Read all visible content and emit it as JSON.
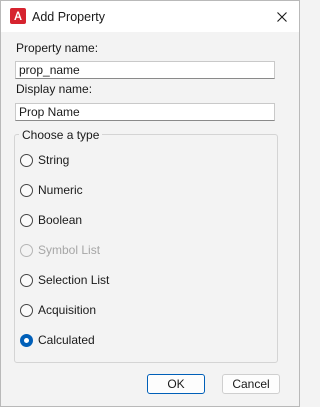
{
  "window": {
    "title": "Add Property",
    "icon": "app-a-icon",
    "accent_color": "#d6232f"
  },
  "form": {
    "property_name_label": "Property name:",
    "property_name_value": "prop_name",
    "display_name_label": "Display name:",
    "display_name_value": "Prop Name"
  },
  "type_group": {
    "legend": "Choose a type",
    "options": [
      {
        "label": "String",
        "checked": false,
        "disabled": false
      },
      {
        "label": "Numeric",
        "checked": false,
        "disabled": false
      },
      {
        "label": "Boolean",
        "checked": false,
        "disabled": false
      },
      {
        "label": "Symbol List",
        "checked": false,
        "disabled": true
      },
      {
        "label": "Selection List",
        "checked": false,
        "disabled": false
      },
      {
        "label": "Acquisition",
        "checked": false,
        "disabled": false
      },
      {
        "label": "Calculated",
        "checked": true,
        "disabled": false
      }
    ]
  },
  "buttons": {
    "ok_label": "OK",
    "cancel_label": "Cancel"
  },
  "colors": {
    "selected_radio": "#005fb8",
    "disabled_text": "#a6a6a6"
  }
}
